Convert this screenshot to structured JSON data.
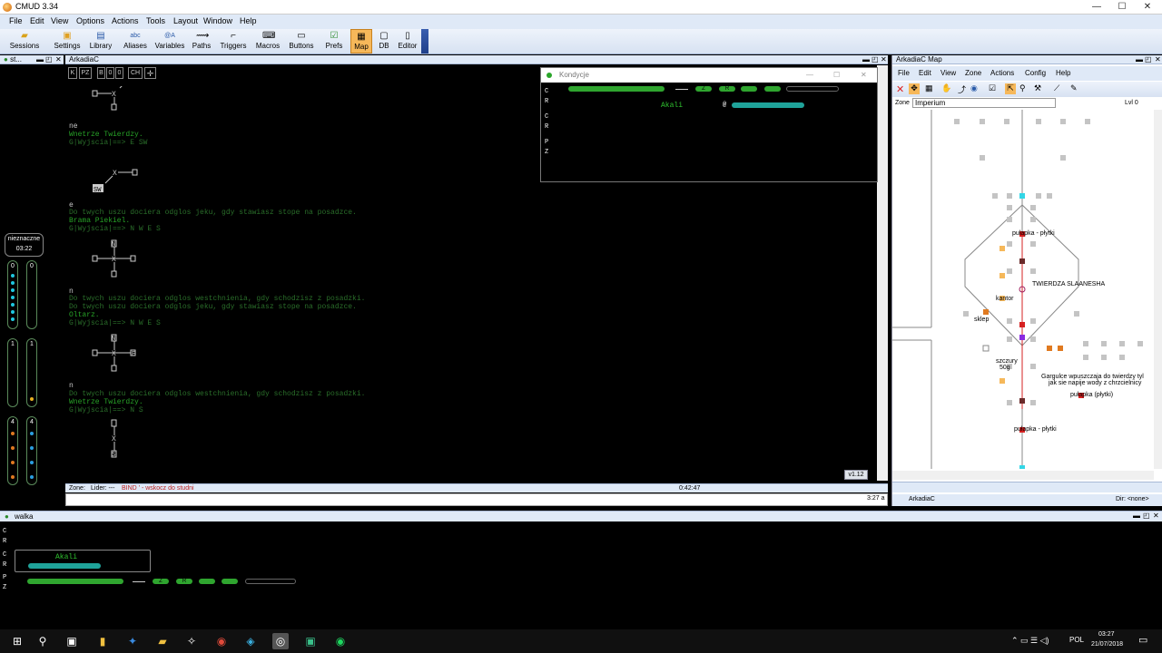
{
  "app": {
    "title": "CMUD 3.34"
  },
  "menu": [
    "File",
    "Edit",
    "View",
    "Options",
    "Actions",
    "Tools",
    "Layout",
    "Window",
    "Help"
  ],
  "toolbar": [
    "Sessions",
    "Settings",
    "Library",
    "Aliases",
    "Variables",
    "Paths",
    "Triggers",
    "Macros",
    "Buttons",
    "Prefs",
    "Map",
    "DB",
    "Editor"
  ],
  "session_pane": {
    "title": "st..."
  },
  "left_widget": {
    "status": "nieznaczne",
    "time": "03:22",
    "counters": [
      "0",
      "0",
      "1",
      "1",
      "4",
      "4"
    ]
  },
  "main_pane": {
    "title": "ArkadiaC",
    "buttons": [
      "K",
      "PZ",
      "B",
      "0",
      "0",
      "CH"
    ],
    "lines": [
      {
        "t": "ne",
        "c": "wt"
      },
      {
        "t": "Wnetrze Twierdzy.",
        "c": "g1"
      },
      {
        "t": "G|Wyjscia|==> E SW",
        "c": "g2",
        "hl": "E SW"
      },
      {
        "t": "e",
        "c": "wt"
      },
      {
        "t": "Do twych uszu dociera odglos jeku, gdy stawiasz stope na posadzce.",
        "c": "g2"
      },
      {
        "t": "Brama Piekiel.",
        "c": "g1"
      },
      {
        "t": "G|Wyjscia|==> N W E S",
        "c": "g2"
      },
      {
        "t": "n",
        "c": "wt"
      },
      {
        "t": "Do twych uszu dociera odglos westchnienia, gdy schodzisz z posadzki.",
        "c": "g2"
      },
      {
        "t": "Do twych uszu dociera odglos jeku, gdy stawiasz stope na posadzce.",
        "c": "g2"
      },
      {
        "t": "Oltarz.",
        "c": "g1"
      },
      {
        "t": "G|Wyjscia|==> N W E S",
        "c": "g2"
      },
      {
        "t": "n",
        "c": "wt"
      },
      {
        "t": "Do twych uszu dociera odglos westchnienia, gdy schodzisz z posadzki.",
        "c": "g2"
      },
      {
        "t": "Wnetrze Twierdzy.",
        "c": "g1"
      },
      {
        "t": "G|Wyjscia|==> N S",
        "c": "g2"
      }
    ],
    "mini_labels": [
      "SW",
      "N",
      "S",
      "N",
      "E",
      "S"
    ],
    "version": "v1.12",
    "status": {
      "zone": "Zone:",
      "lider": "Lider: ---",
      "bind": "BIND ' - wskocz do studni",
      "time": "0:42:47",
      "clock": "3:27 a"
    }
  },
  "kondycje": {
    "title": "Kondycje",
    "letters": [
      "C",
      "R",
      "C",
      "R",
      "P",
      "Z"
    ],
    "pills": [
      "Z",
      "R"
    ],
    "name": "Akali"
  },
  "map_window": {
    "title": "ArkadiaC Map",
    "menu": [
      "File",
      "Edit",
      "View",
      "Zone",
      "Actions",
      "Config",
      "Help"
    ],
    "zone_label": "Zone",
    "zone_value": "Imperium",
    "level": "Lvl 0",
    "labels": [
      "pułapka - płytki",
      "TWIERDZA SLAANESHA",
      "kantor",
      "sklep",
      "szczury",
      "50g",
      "Gargulce wpuszczaja do twierdzy tyl",
      "jak sie napije wody z chrzcielnicy",
      "pułapka (płytki)",
      "pułapka - płytki"
    ],
    "footer_left": "ArkadiaC",
    "footer_right": "Dir: <none>"
  },
  "walka": {
    "title": "walka",
    "letters": [
      "C",
      "R",
      "C",
      "R",
      "P",
      "Z"
    ],
    "name": "Akali",
    "pills": [
      "Z",
      "R"
    ]
  },
  "taskbar": {
    "lang": "POL",
    "time": "03:27",
    "date": "21/07/2018"
  },
  "colors": {
    "green": "#2fa52f",
    "teal": "#1fa39a",
    "accent": "#f6b85a",
    "red": "#d62020"
  }
}
